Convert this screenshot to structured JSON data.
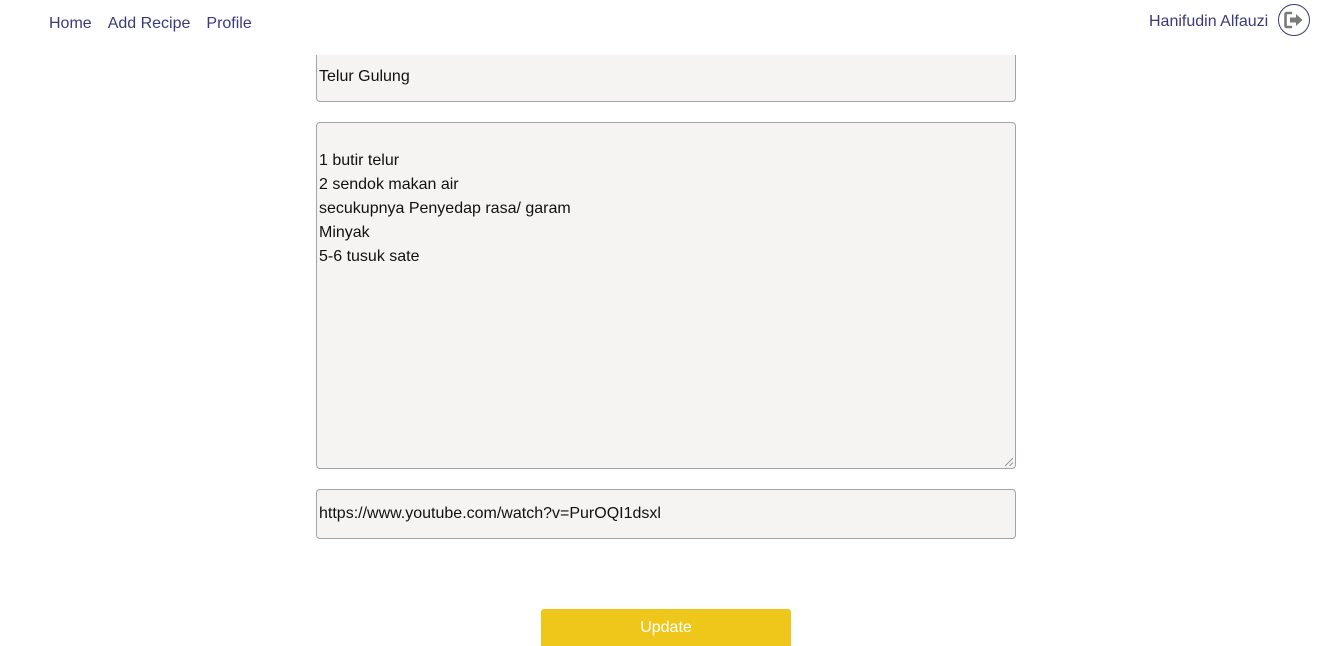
{
  "nav": {
    "links": [
      "Home",
      "Add Recipe",
      "Profile"
    ],
    "user_name": "Hanifudin Alfauzi",
    "logout_icon": "sign-out-icon"
  },
  "form": {
    "title_value": "Telur Gulung",
    "ingredients_value": "1 butir telur\n2 sendok makan air\nsecukupnya Penyedap rasa/ garam\nMinyak\n5-6 tusuk sate",
    "video_value": "https://www.youtube.com/watch?v=PurOQI1dsxl",
    "submit_label": "Update"
  },
  "colors": {
    "nav_text": "#3a3a7a",
    "button_bg": "#eec71a",
    "field_bg": "#f5f4f2"
  }
}
